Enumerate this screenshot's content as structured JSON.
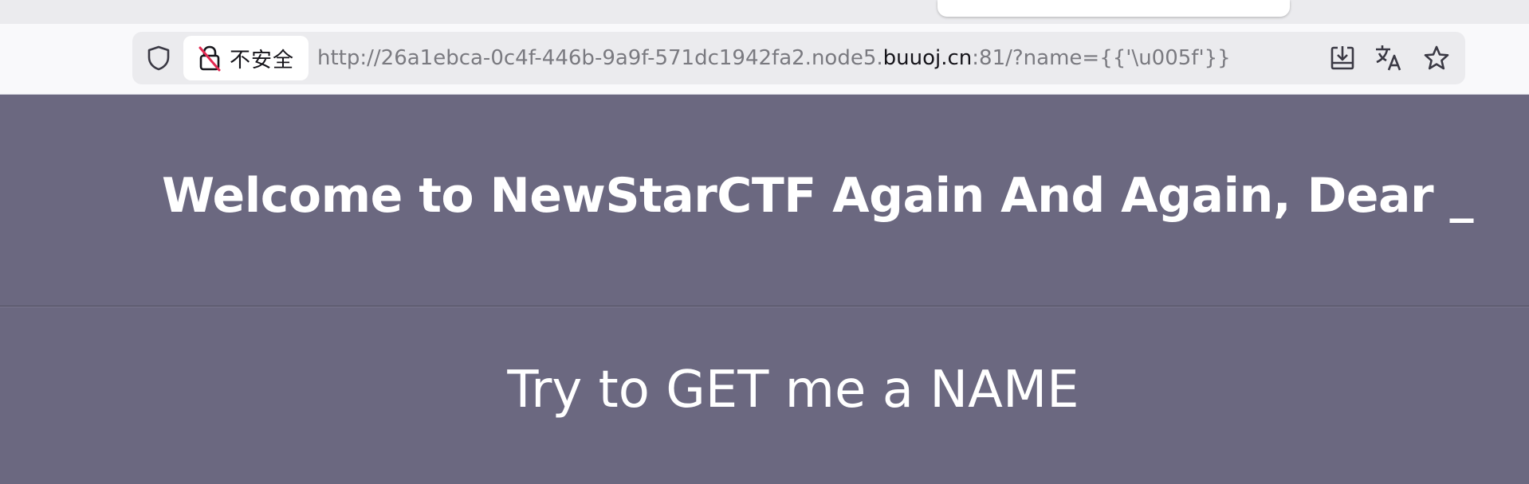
{
  "browser": {
    "security_label": "不安全",
    "url": {
      "prefix": "http://26a1ebca-0c4f-446b-9a9f-571dc1942fa2.node5.",
      "domain": "buuoj.cn",
      "suffix": ":81/?name={{'\\u005f'}}"
    },
    "icons": {
      "shield": "shield-icon",
      "not_secure": "not-secure-lock-icon",
      "download": "download-icon",
      "translate": "translate-icon",
      "bookmark": "bookmark-star-icon"
    },
    "colors": {
      "not_secure_accent": "#e22850",
      "url_text": "#7a7a80",
      "domain_text": "#15141a"
    }
  },
  "page": {
    "heading": "Welcome to NewStarCTF Again And Again, Dear _",
    "prompt": "Try to GET me a NAME",
    "colors": {
      "background": "#6b6880",
      "text": "#ffffff"
    }
  }
}
